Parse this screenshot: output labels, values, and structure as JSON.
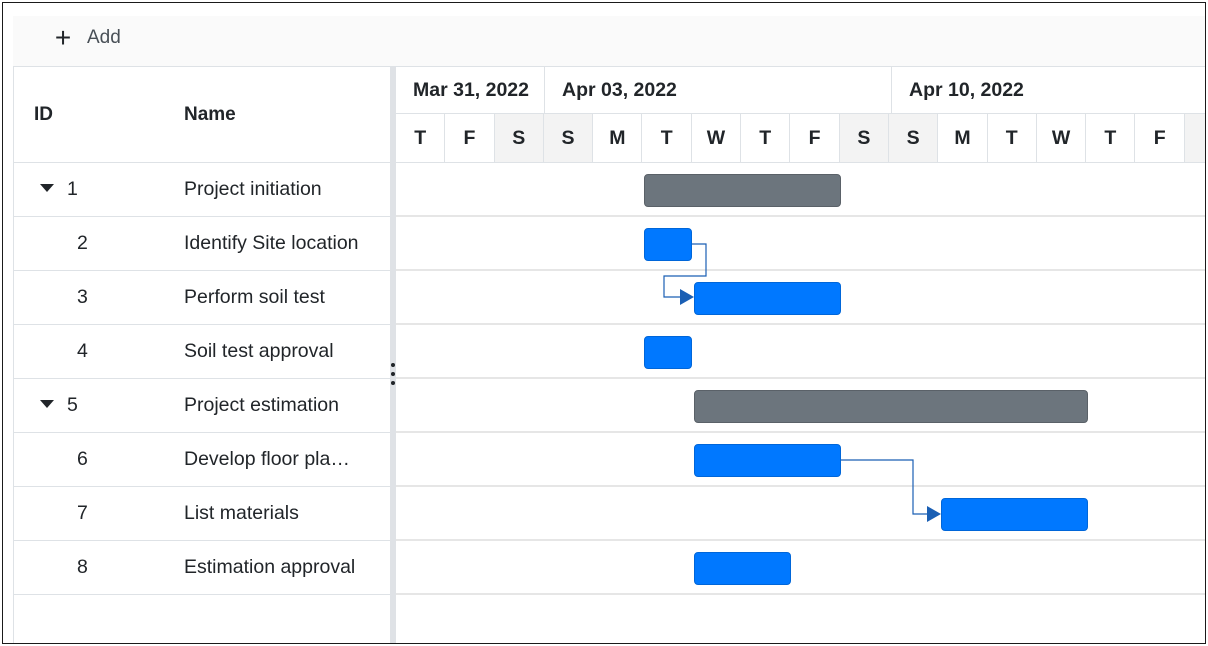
{
  "toolbar": {
    "add_label": "Add",
    "add_icon": "plus-icon"
  },
  "grid": {
    "columns": {
      "id": "ID",
      "name": "Name"
    },
    "rows": [
      {
        "id": "1",
        "name": "Project initiation",
        "parent": true
      },
      {
        "id": "2",
        "name": "Identify Site location",
        "parent": false
      },
      {
        "id": "3",
        "name": "Perform soil test",
        "parent": false
      },
      {
        "id": "4",
        "name": "Soil test approval",
        "parent": false
      },
      {
        "id": "5",
        "name": "Project estimation",
        "parent": true
      },
      {
        "id": "6",
        "name": "Develop floor pla…",
        "parent": false
      },
      {
        "id": "7",
        "name": "List materials",
        "parent": false
      },
      {
        "id": "8",
        "name": "Estimation approval",
        "parent": false
      }
    ]
  },
  "timeline": {
    "weeks": [
      "Mar 31, 2022",
      "Apr 03, 2022",
      "Apr 10, 2022"
    ],
    "days": [
      "T",
      "F",
      "S",
      "S",
      "M",
      "T",
      "W",
      "T",
      "F",
      "S",
      "S",
      "M",
      "T",
      "W",
      "T",
      "F"
    ]
  },
  "colors": {
    "summary_bar": "#6c757d",
    "task_bar": "#0078ff",
    "connector": "#1a5fb4"
  }
}
